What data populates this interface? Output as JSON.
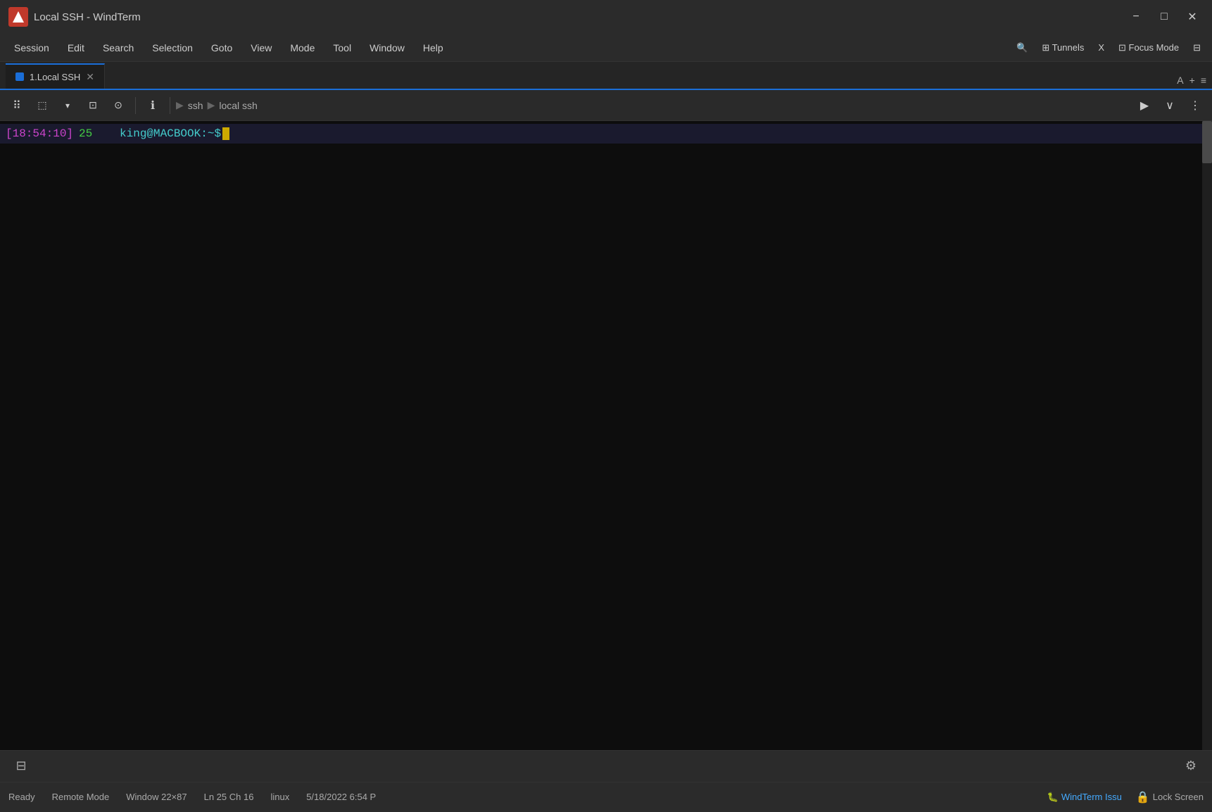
{
  "titleBar": {
    "appName": "Local SSH - WindTerm",
    "logoAlt": "WindTerm logo",
    "minimizeLabel": "−",
    "maximizeLabel": "□",
    "closeLabel": "✕"
  },
  "menuBar": {
    "items": [
      "Session",
      "Edit",
      "Search",
      "Selection",
      "Goto",
      "View",
      "Mode",
      "Tool",
      "Window",
      "Help"
    ],
    "right": [
      {
        "label": "🔍",
        "name": "search-menu"
      },
      {
        "label": "⊞ Tunnels",
        "name": "tunnels-menu"
      },
      {
        "label": "X",
        "name": "x-menu"
      },
      {
        "label": "⊡ Focus Mode",
        "name": "focus-mode-menu"
      },
      {
        "label": "⊟",
        "name": "layout-menu"
      }
    ]
  },
  "tabBar": {
    "tabs": [
      {
        "id": "tab-1",
        "label": "1.Local SSH",
        "active": true
      }
    ],
    "rightButtons": [
      "A",
      "+",
      "≡"
    ]
  },
  "toolbar": {
    "buttons": [
      {
        "icon": "⠿",
        "name": "drag-handle"
      },
      {
        "icon": "⬚↓",
        "name": "new-session-dropdown"
      },
      {
        "icon": "⬚↑",
        "name": "new-window"
      },
      {
        "icon": "⊙",
        "name": "clone-session"
      },
      {
        "icon": "ℹ",
        "name": "info"
      }
    ],
    "breadcrumb": {
      "parts": [
        "ssh",
        "local ssh"
      ]
    },
    "rightButtons": [
      {
        "icon": "▶",
        "name": "run"
      },
      {
        "icon": "∨",
        "name": "expand"
      },
      {
        "icon": "⋮",
        "name": "more"
      }
    ]
  },
  "terminal": {
    "lines": [
      {
        "time": "[18:54:10]",
        "lineNum": "25",
        "prompt": "king@MACBOOK:~$",
        "cursor": true
      }
    ]
  },
  "statusBar": {
    "bottom": {
      "ready": "Ready",
      "remoteMode": "Remote Mode",
      "windowSize": "Window 22×87",
      "position": "Ln 25 Ch 16",
      "os": "linux",
      "datetime": "5/18/2022 6:54 P",
      "windtermIssue": "WindTerm Issu",
      "lockScreen": "Lock Screen"
    }
  }
}
